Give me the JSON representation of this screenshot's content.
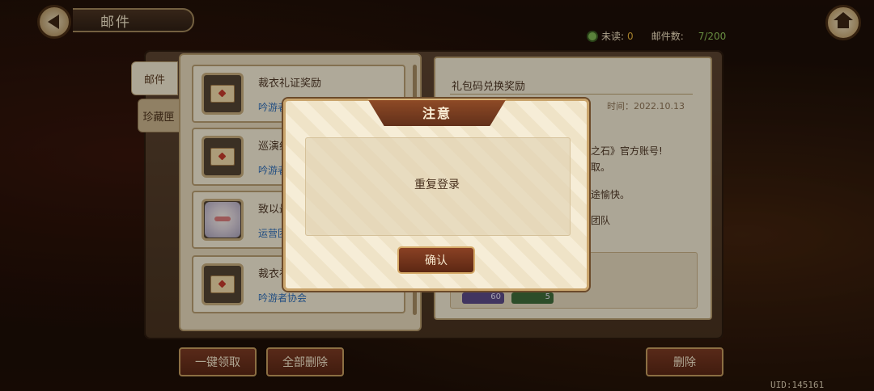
{
  "header": {
    "title": "邮件"
  },
  "stats": {
    "unread_label": "未读:",
    "unread_value": "0",
    "count_label": "邮件数:",
    "count_value": "7/200"
  },
  "tabs": [
    {
      "label": "邮件"
    },
    {
      "label": "珍藏匣"
    }
  ],
  "mail_list": [
    {
      "title": "裁衣礼证奖励",
      "sender": "吟游者协会",
      "icon": "envelope-icon"
    },
    {
      "title": "巡演纪",
      "sender": "吟游者",
      "icon": "envelope-icon"
    },
    {
      "title": "致以最",
      "sender": "运营团",
      "icon": "avatar-icon"
    },
    {
      "title": "裁衣礼",
      "sender": "吟游者协会",
      "icon": "envelope-icon"
    }
  ],
  "detail": {
    "title": "礼包码兑换奖励",
    "time": "时间：2022.10.13",
    "lines": [
      "之石》官方账号!",
      "取。",
      "途愉快。",
      "团队"
    ],
    "rewards": [
      "60",
      "5"
    ]
  },
  "buttons": {
    "claim_all": "一键领取",
    "delete_all": "全部删除",
    "delete": "删除"
  },
  "uid": "UID:145161",
  "dialog": {
    "title": "注意",
    "message": "重复登录",
    "confirm": "确认"
  },
  "colors": {
    "accent": "#c39a5e",
    "button": "#6b2f1b",
    "link": "#2f6cb4"
  }
}
